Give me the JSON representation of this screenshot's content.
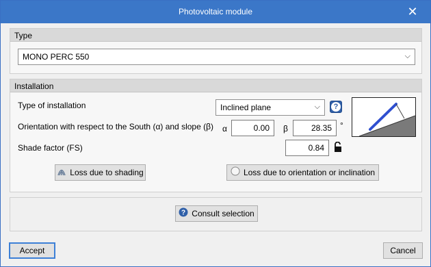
{
  "window": {
    "title": "Photovoltaic module",
    "close_icon": "close-icon"
  },
  "type_group": {
    "header": "Type",
    "module_select": "MONO PERC 550"
  },
  "installation_group": {
    "header": "Installation",
    "type_of_installation_label": "Type of installation",
    "type_of_installation_value": "Inclined plane",
    "orientation_label": "Orientation with respect to the South (α) and slope (β)",
    "alpha_symbol": "α",
    "alpha_value": "0.00",
    "beta_symbol": "β",
    "beta_value": "28.35",
    "degree_symbol": "°",
    "shade_label": "Shade factor (FS)",
    "shade_value": "0.84",
    "loss_shading_button": "Loss due to shading",
    "loss_orientation_button": "Loss due to orientation or inclination"
  },
  "consult_button": "Consult selection",
  "footer": {
    "accept": "Accept",
    "cancel": "Cancel"
  },
  "colors": {
    "titlebar": "#3b77c8",
    "diagram_panel": "#2f4fd0",
    "help_icon": "#2f5fa8"
  }
}
